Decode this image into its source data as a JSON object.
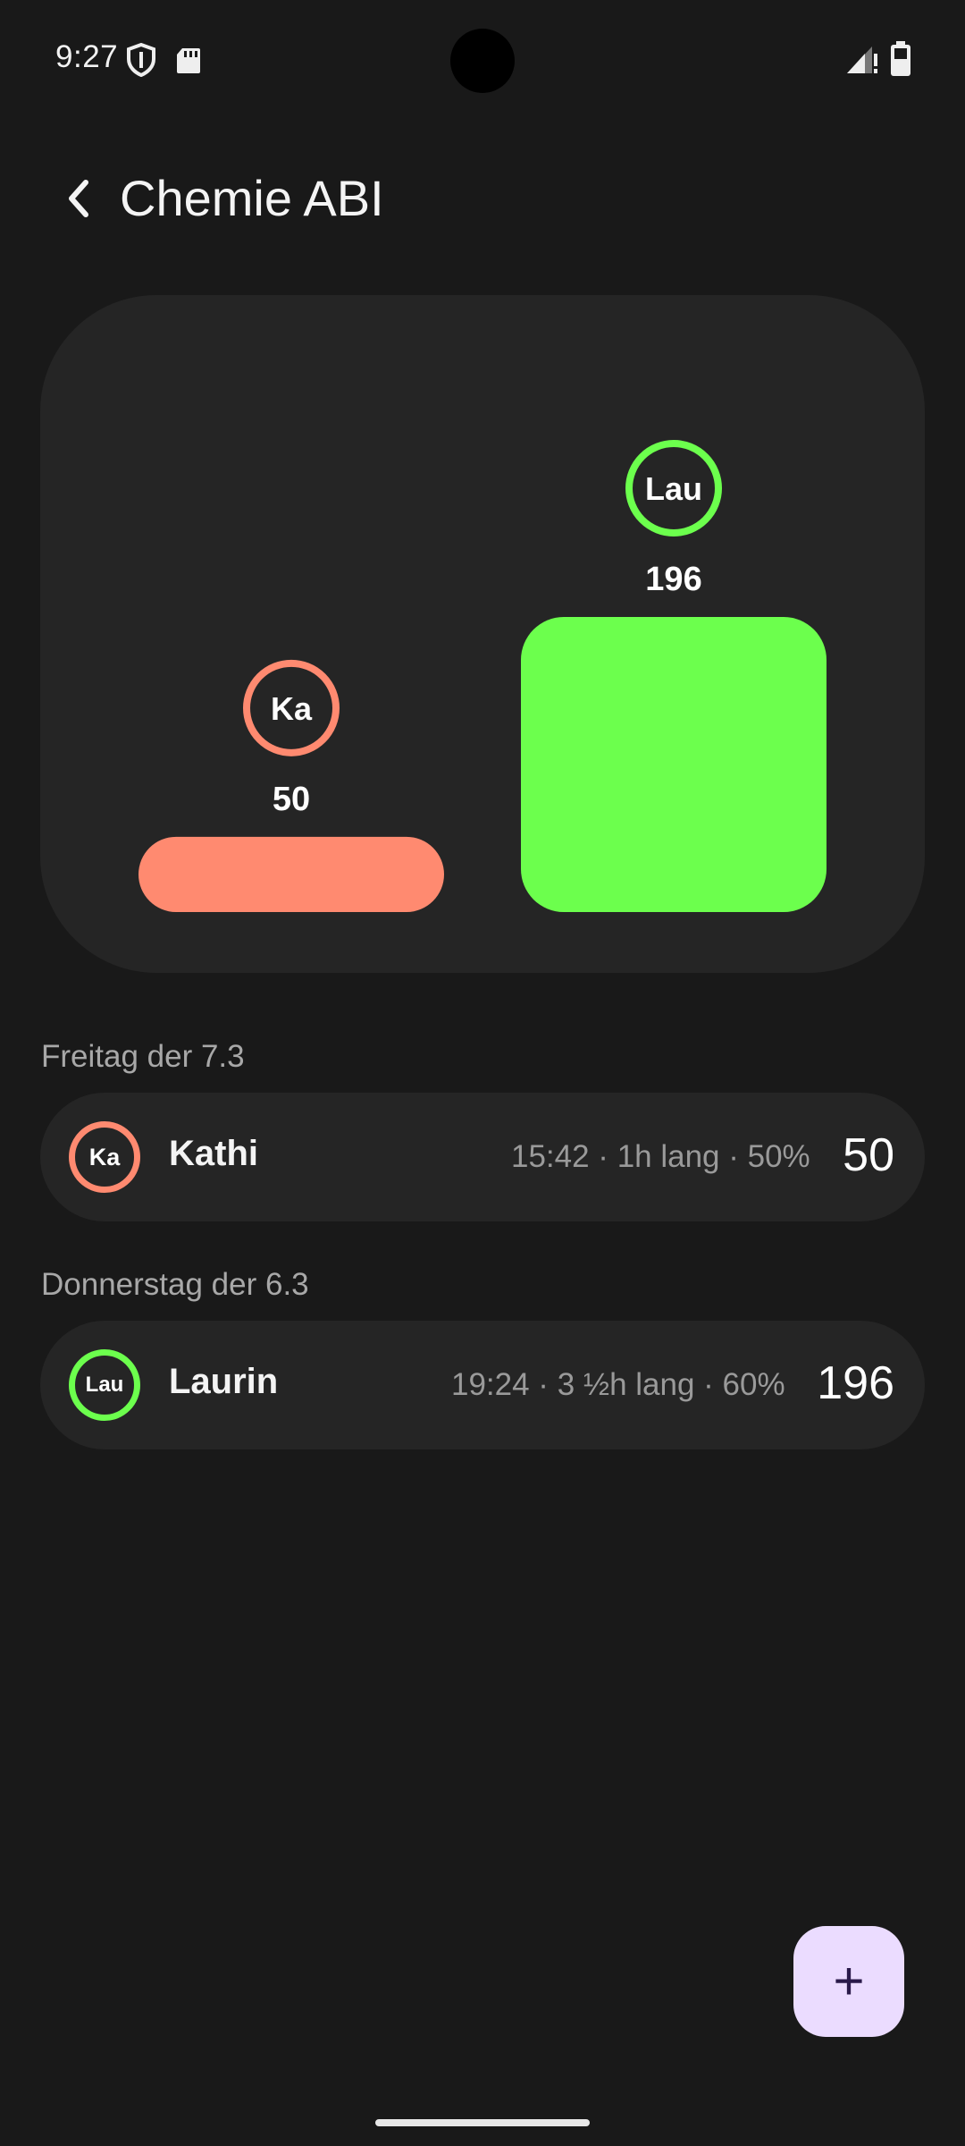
{
  "status_bar": {
    "time": "9:27",
    "icons": [
      "shield-icon",
      "sd-card-icon",
      "signal-icon",
      "battery-icon"
    ]
  },
  "header": {
    "title": "Chemie ABI",
    "back_icon": "chevron-left-icon"
  },
  "chart_data": {
    "type": "bar",
    "categories": [
      "Ka",
      "Lau"
    ],
    "values": [
      50,
      196
    ],
    "colors": [
      "#ff8a70",
      "#6cff4d"
    ],
    "title": "",
    "xlabel": "",
    "ylabel": "",
    "data_labels": [
      "50",
      "196"
    ]
  },
  "sessions": [
    {
      "date": "Freitag der 7.3",
      "initials": "Ka",
      "name": "Kathi",
      "meta": "15:42 · 1h lang · 50%",
      "score": "50",
      "color": "#ff8a70"
    },
    {
      "date": "Donnerstag der 6.3",
      "initials": "Lau",
      "name": "Laurin",
      "meta": "19:24 · 3 ½h lang · 60%",
      "score": "196",
      "color": "#6cff4d"
    }
  ],
  "fab": {
    "label": "+",
    "icon": "plus-icon"
  }
}
